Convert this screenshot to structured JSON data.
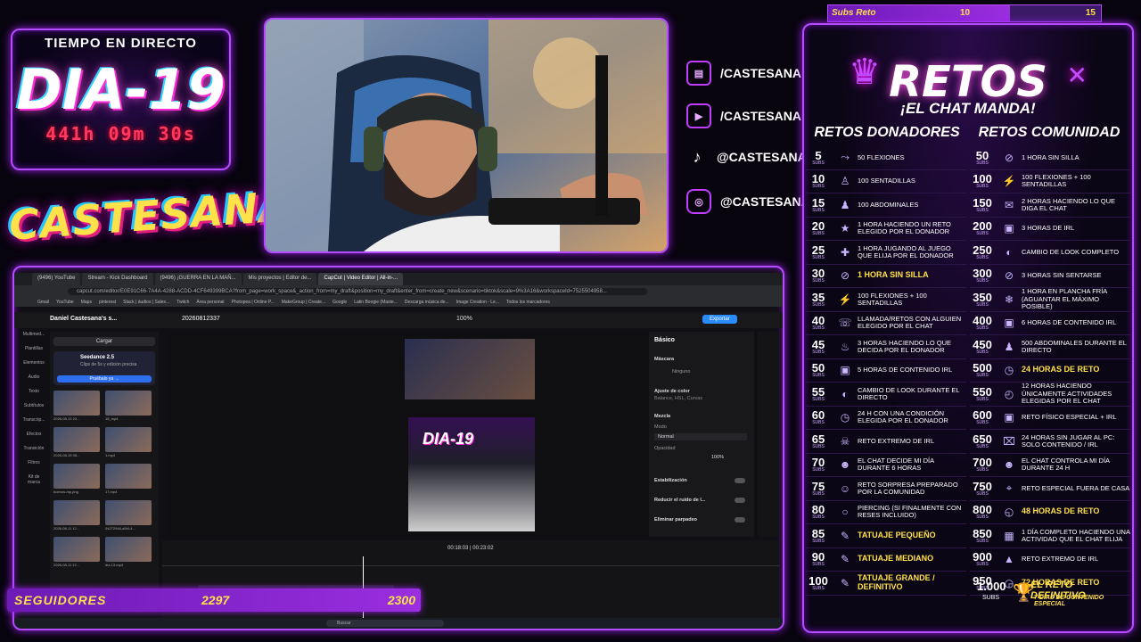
{
  "timer": {
    "heading": "TIEMPO EN DIRECTO",
    "day": "DIA-19",
    "elapsed": "441h 09m 30s"
  },
  "brand": {
    "logo_text": "CASTESANA"
  },
  "socials": [
    {
      "icon": "twitch-icon",
      "handle": "/CASTESANA"
    },
    {
      "icon": "youtube-icon",
      "handle": "/CASTESANA"
    },
    {
      "icon": "tiktok-icon",
      "handle": "@CASTESANA"
    },
    {
      "icon": "instagram-icon",
      "handle": "@CASTESANA_"
    }
  ],
  "followers": {
    "label": "SEGUIDORES",
    "current": "2297",
    "goal": "2300",
    "progress": 0.9987
  },
  "subs_goal": {
    "label": "Subs Reto",
    "current": "10",
    "goal": "15",
    "progress": 0.667
  },
  "retos": {
    "title": "RETOS",
    "subtitle": "¡EL CHAT MANDA!",
    "donadores_title": "RETOS DONADORES",
    "comunidad_title": "RETOS COMUNIDAD",
    "unit": "SUBS",
    "donadores": [
      {
        "n": "5",
        "text": "50 FLEXIONES",
        "hl": false,
        "icon": "pushup-icon"
      },
      {
        "n": "10",
        "text": "100 SENTADILLAS",
        "hl": false,
        "icon": "squat-icon"
      },
      {
        "n": "15",
        "text": "100 ABDOMINALES",
        "hl": false,
        "icon": "abs-icon"
      },
      {
        "n": "20",
        "text": "1 HORA HACIENDO UN RETO ELEGIDO POR EL DONADOR",
        "hl": false,
        "icon": "star-icon"
      },
      {
        "n": "25",
        "text": "1 HORA JUGANDO AL JUEGO QUE ELIJA POR EL DONADOR",
        "hl": false,
        "icon": "gamepad-icon"
      },
      {
        "n": "30",
        "text": "1 HORA SIN SILLA",
        "hl": true,
        "icon": "no-chair-icon"
      },
      {
        "n": "35",
        "text": "100 FLEXIONES + 100 SENTADILLAS",
        "hl": false,
        "icon": "workout-icon"
      },
      {
        "n": "40",
        "text": "LLAMADA/RETOS CON ALGUIEN ELEGIDO POR EL CHAT",
        "hl": false,
        "icon": "phone-icon"
      },
      {
        "n": "45",
        "text": "3 HORAS HACIENDO LO QUE DECIDA POR EL DONADOR",
        "hl": false,
        "icon": "fire-icon"
      },
      {
        "n": "50",
        "text": "5 HORAS DE CONTENIDO IRL",
        "hl": false,
        "icon": "irl-icon"
      },
      {
        "n": "55",
        "text": "CAMBIO DE LOOK DURANTE EL DIRECTO",
        "hl": false,
        "icon": "hair-icon"
      },
      {
        "n": "60",
        "text": "24 H CON UNA CONDICIÓN ELEGIDA POR EL DONADOR",
        "hl": false,
        "icon": "24h-icon"
      },
      {
        "n": "65",
        "text": "RETO EXTREMO DE IRL",
        "hl": false,
        "icon": "skull-icon"
      },
      {
        "n": "70",
        "text": "EL CHAT DECIDE MI DÍA DURANTE 6 HORAS",
        "hl": false,
        "icon": "people-icon"
      },
      {
        "n": "75",
        "text": "RETO SORPRESA PREPARADO POR LA COMUNIDAD",
        "hl": false,
        "icon": "community-icon"
      },
      {
        "n": "80",
        "text": "PIERCING (SI FINALMENTE CON RESES INCLUIDO)",
        "hl": false,
        "icon": "piercing-icon"
      },
      {
        "n": "85",
        "text": "TATUAJE PEQUEÑO",
        "hl": true,
        "icon": "tattoo-icon"
      },
      {
        "n": "90",
        "text": "TATUAJE MEDIANO",
        "hl": true,
        "icon": "tattoo-icon"
      },
      {
        "n": "100",
        "text": "TATUAJE GRANDE / DEFINITIVO",
        "hl": true,
        "icon": "tattoo-icon"
      }
    ],
    "comunidad": [
      {
        "n": "50",
        "text": "1 HORA SIN SILLA",
        "hl": false,
        "icon": "no-chair-icon"
      },
      {
        "n": "100",
        "text": "100 FLEXIONES + 100 SENTADILLAS",
        "hl": false,
        "icon": "workout-icon"
      },
      {
        "n": "150",
        "text": "2 HORAS HACIENDO LO QUE DIGA EL CHAT",
        "hl": false,
        "icon": "chat-icon"
      },
      {
        "n": "200",
        "text": "3 HORAS DE IRL",
        "hl": false,
        "icon": "irl-icon"
      },
      {
        "n": "250",
        "text": "CAMBIO DE LOOK COMPLETO",
        "hl": false,
        "icon": "hair-icon"
      },
      {
        "n": "300",
        "text": "3 HORAS SIN SENTARSE",
        "hl": false,
        "icon": "no-chair-icon"
      },
      {
        "n": "350",
        "text": "1 HORA EN PLANCHA FRÍA (AGUANTAR EL MÁXIMO POSIBLE)",
        "hl": false,
        "icon": "snowflake-icon"
      },
      {
        "n": "400",
        "text": "6 HORAS DE CONTENIDO IRL",
        "hl": false,
        "icon": "irl-icon"
      },
      {
        "n": "450",
        "text": "500 ABDOMINALES DURANTE EL DIRECTO",
        "hl": false,
        "icon": "abs-icon"
      },
      {
        "n": "500",
        "text": "24 HORAS DE RETO",
        "hl": true,
        "icon": "24h-icon"
      },
      {
        "n": "550",
        "text": "12 HORAS HACIENDO ÚNICAMENTE ACTIVIDADES ELEGIDAS POR EL CHAT",
        "hl": false,
        "icon": "12h-icon"
      },
      {
        "n": "600",
        "text": "RETO FÍSICO ESPECIAL + IRL",
        "hl": false,
        "icon": "irl-icon"
      },
      {
        "n": "650",
        "text": "24 HORAS SIN JUGAR AL PC: SOLO CONTENIDO / IRL",
        "hl": false,
        "icon": "no-pc-icon"
      },
      {
        "n": "700",
        "text": "EL CHAT CONTROLA MI DÍA DURANTE 24 H",
        "hl": false,
        "icon": "people-icon"
      },
      {
        "n": "750",
        "text": "RETO ESPECIAL FUERA DE CASA",
        "hl": false,
        "icon": "location-icon"
      },
      {
        "n": "800",
        "text": "48 HORAS DE RETO",
        "hl": true,
        "icon": "48h-icon"
      },
      {
        "n": "850",
        "text": "1 DÍA COMPLETO HACIENDO UNA ACTIVIDAD QUE EL CHAT ELIJA",
        "hl": false,
        "icon": "calendar-icon"
      },
      {
        "n": "900",
        "text": "RETO EXTREMO DE IRL",
        "hl": false,
        "icon": "mountain-icon"
      },
      {
        "n": "950",
        "text": "72 HORAS DE RETO",
        "hl": true,
        "icon": "72h-icon"
      }
    ],
    "final": {
      "n": "1.000",
      "unit": "SUBS",
      "title": "EL RETO DEFINITIVO",
      "desc": "7 DÍAS DE CONTENIDO ESPECIAL"
    }
  },
  "screen": {
    "tabs": [
      "(9496) YouTube",
      "Stream - Kick Dashboard",
      "(9496) ¡GUERRA EN LA MAÑ...",
      "Mis proyectos | Editor de...",
      "CapCut | Video Editor | All-in-..."
    ],
    "url": "capcut.com/editor/E0E91C66-7A4A-4288-ACDD-4CF649399BCA?from_page=work_space&_action_from=my_draft&position=my_draft&enter_from=create_new&scenario=tiktok&scale=9%3A16&workspaceId=7525504958...",
    "bookmarks": [
      "Gmail",
      "YouTube",
      "Maps",
      "pinterest",
      "Stack | áudios | Sales...",
      "Twitch",
      "Área personal",
      "Photopea | Online P...",
      "MakeGroup | Create...",
      "Google",
      "Latin Boogie (Maste...",
      "Descarga música de...",
      "Image Creation - Le...",
      "Todos los marcadores"
    ],
    "project": "Daniel Castesana's s...",
    "date": "20260812337",
    "zoom": "100%",
    "export": "Exportar",
    "upload": "Cargar",
    "promo_title": "Seedance 2.5",
    "promo_desc": "Clips de 5s y edición precisa",
    "promo_btn": "Pruébalo ya →",
    "rail": [
      "Multimed...",
      "Plantillas",
      "Elementos",
      "Audio",
      "Texto",
      "Subtítulos",
      "Transcrip...",
      "Efectos",
      "Transición",
      "Filtros",
      "Kit de marca"
    ],
    "thumbs": [
      "2026-08-13 23...",
      "18_mp4",
      "2026-08-15 08...",
      "1.mp4",
      "buenos-mp.png",
      "17.mp4",
      "2026-08-11 12...",
      "04272946-a5t4-4...",
      "2026-08-11 12...",
      "día 13.mp4"
    ],
    "props_title": "Básico",
    "props": [
      "Máscara",
      "Ninguno",
      "Ajuste de color",
      "Balance, HSL, Curvas",
      "Mezcla",
      "Modo",
      "Normal",
      "Opacidad",
      "100%",
      "Estabilización",
      "Reducir el ruido de l...",
      "Eliminar parpadeo"
    ],
    "timecode": "00:18:03  |  00:23:02",
    "search": "Buscar"
  }
}
